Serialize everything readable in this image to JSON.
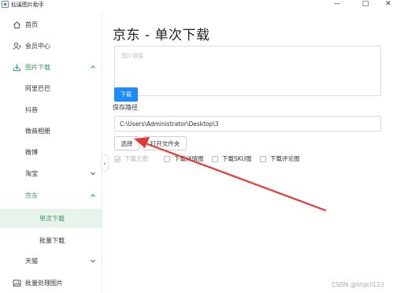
{
  "window": {
    "title": "仙溪图片助手",
    "minimize": "—",
    "maximize": "□",
    "close": "✕"
  },
  "sidebar": {
    "items": [
      {
        "label": "首页",
        "icon": "home-icon"
      },
      {
        "label": "会员中心",
        "icon": "user-icon"
      },
      {
        "label": "图片下载",
        "icon": "download-icon"
      },
      {
        "label": "阿里巴巴"
      },
      {
        "label": "抖音"
      },
      {
        "label": "微商相册"
      },
      {
        "label": "微博"
      },
      {
        "label": "淘宝"
      },
      {
        "label": "京东"
      },
      {
        "label": "单次下载"
      },
      {
        "label": "批量下载"
      },
      {
        "label": "天猫"
      },
      {
        "label": "批量处理图片",
        "icon": "image-icon"
      }
    ],
    "collapse_handle": "‹"
  },
  "main": {
    "title": "京东 - 单次下载",
    "url_placeholder": "图片链接",
    "download_button": "下载",
    "path_label": "保存路径",
    "path_value": "C:\\Users\\Administrator\\Desktop\\3",
    "choose_button": "选择",
    "open_folder_button": "打开文件夹",
    "options": [
      {
        "label": "下载主图",
        "checked": true,
        "disabled": true
      },
      {
        "label": "下载详情图",
        "checked": false,
        "disabled": false
      },
      {
        "label": "下载SKU图",
        "checked": false,
        "disabled": false
      },
      {
        "label": "下载评论图",
        "checked": false,
        "disabled": false
      }
    ]
  },
  "watermark": "CSDN @htqkll123",
  "colors": {
    "accent_green": "#2e9b5e",
    "primary_blue": "#1a8cff",
    "annotation_red": "#e53935"
  }
}
